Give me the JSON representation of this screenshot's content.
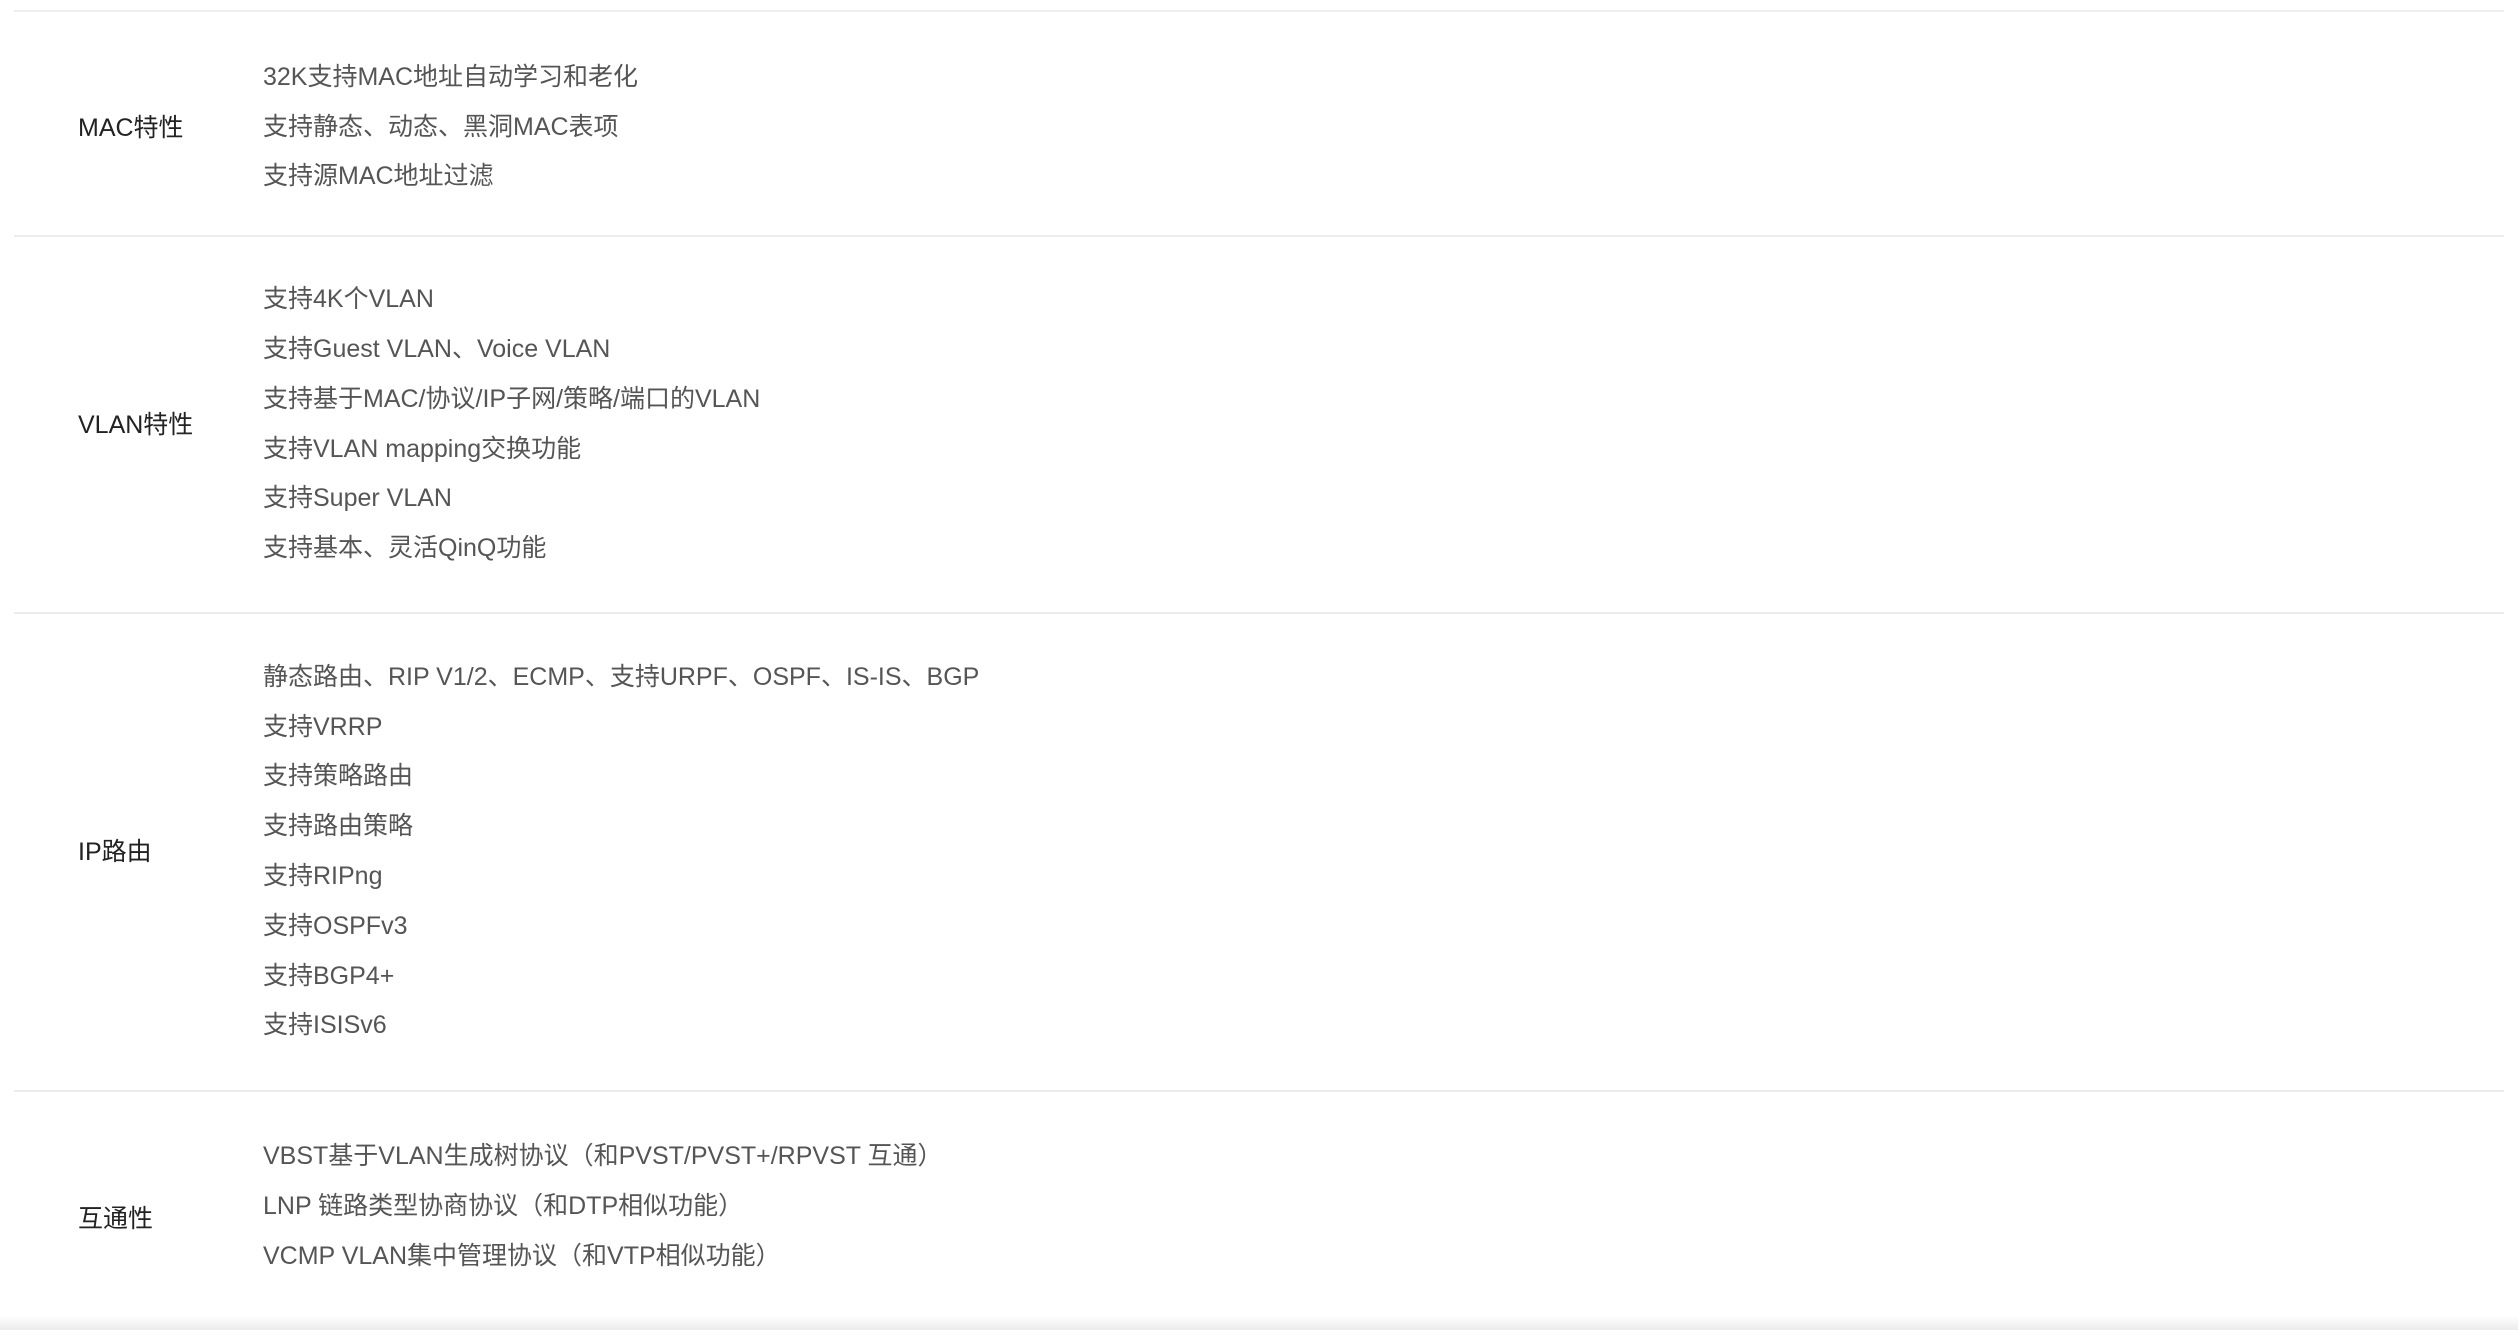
{
  "rows": [
    {
      "label": "MAC特性",
      "values": [
        "32K支持MAC地址自动学习和老化",
        "支持静态、动态、黑洞MAC表项",
        "支持源MAC地址过滤"
      ]
    },
    {
      "label": "VLAN特性",
      "values": [
        "支持4K个VLAN",
        "支持Guest VLAN、Voice VLAN",
        "支持基于MAC/协议/IP子网/策略/端口的VLAN",
        "支持VLAN mapping交换功能",
        "支持Super VLAN",
        "支持基本、灵活QinQ功能"
      ]
    },
    {
      "label": "IP路由",
      "values": [
        "静态路由、RIP V1/2、ECMP、支持URPF、OSPF、IS-IS、BGP",
        "支持VRRP",
        "支持策略路由",
        "支持路由策略",
        "支持RIPng",
        "支持OSPFv3",
        "支持BGP4+",
        "支持ISISv6"
      ]
    },
    {
      "label": "互通性",
      "values": [
        "VBST基于VLAN生成树协议（和PVST/PVST+/RPVST 互通）",
        "LNP 链路类型协商协议（和DTP相似功能）",
        "VCMP VLAN集中管理协议（和VTP相似功能）"
      ]
    }
  ]
}
